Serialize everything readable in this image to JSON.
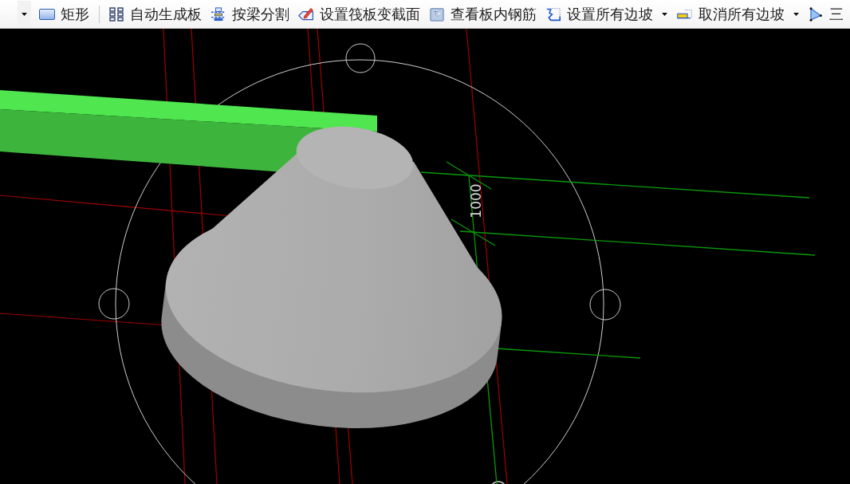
{
  "toolbar": {
    "items": [
      {
        "kind": "dropdown"
      },
      {
        "kind": "button",
        "label": "矩形"
      },
      {
        "kind": "separator"
      },
      {
        "kind": "button",
        "label": "自动生成板"
      },
      {
        "kind": "button",
        "label": "按梁分割"
      },
      {
        "kind": "button",
        "label": "设置筏板变截面"
      },
      {
        "kind": "button",
        "label": "查看板内钢筋"
      },
      {
        "kind": "split",
        "label": "设置所有边坡"
      },
      {
        "kind": "split",
        "label": "取消所有边坡"
      },
      {
        "kind": "button",
        "label": "三"
      }
    ]
  },
  "viewport": {
    "dimension_label": "1000"
  }
}
